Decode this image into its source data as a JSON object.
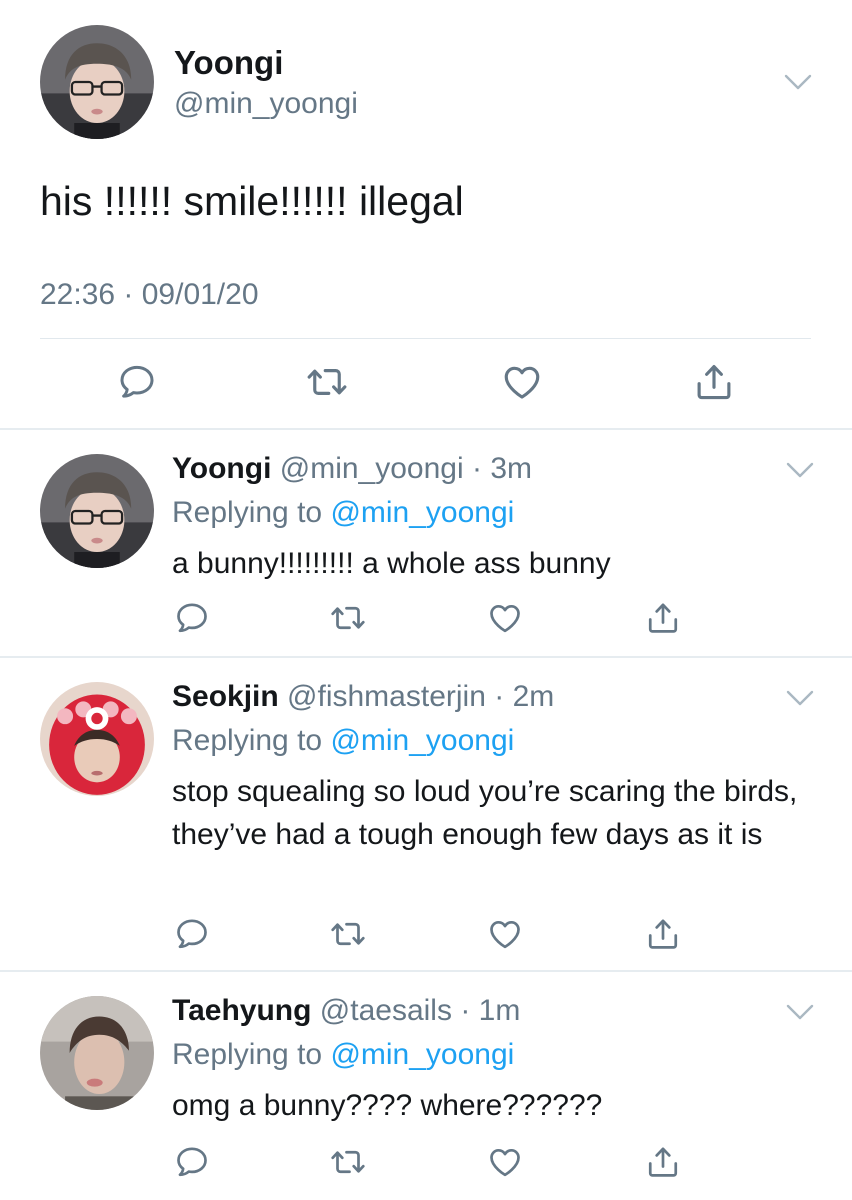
{
  "main_tweet": {
    "author_name": "Yoongi",
    "author_handle": "@min_yoongi",
    "text": "his !!!!!! smile!!!!!! illegal",
    "timestamp": "22:36 · 09/01/20"
  },
  "replies": [
    {
      "author_name": "Yoongi",
      "author_handle": "@min_yoongi",
      "time_ago": "3m",
      "replying_prefix": "Replying to",
      "replying_to": "@min_yoongi",
      "text": "a bunny!!!!!!!!! a whole ass bunny"
    },
    {
      "author_name": "Seokjin",
      "author_handle": "@fishmasterjin",
      "time_ago": "2m",
      "replying_prefix": "Replying to",
      "replying_to": "@min_yoongi",
      "text": "stop squealing so loud you’re scaring the birds, they’ve had a tough enough few days as it is"
    },
    {
      "author_name": "Taehyung",
      "author_handle": "@taesails",
      "time_ago": "1m",
      "replying_prefix": "Replying to",
      "replying_to": "@min_yoongi",
      "text": "omg a bunny???? where??????"
    }
  ],
  "icons": {
    "reply": "speech-bubble-icon",
    "retweet": "retweet-icon",
    "like": "heart-icon",
    "share": "share-icon",
    "menu": "chevron-down-icon"
  },
  "colors": {
    "text": "#14171a",
    "secondary": "#657786",
    "link": "#1da1f2",
    "divider": "#e6ecf0"
  }
}
